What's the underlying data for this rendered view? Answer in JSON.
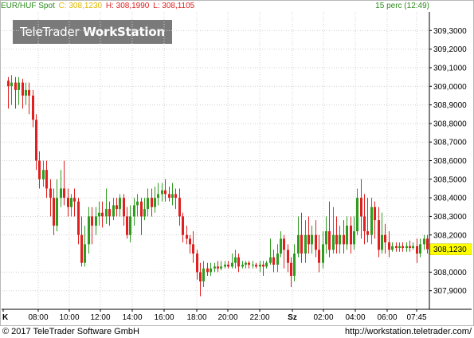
{
  "header": {
    "symbol": "EUR/HUF Spot",
    "close_label": "C: 308,1230",
    "high_label": "H: 308,1990",
    "low_label": "L: 308,1105",
    "timeframe": "15 perc (12:49)"
  },
  "logo": {
    "part1": "TeleTrader ",
    "part2": "WorkStation"
  },
  "footer": {
    "copyright": "© 2017 TeleTrader Software GmbH",
    "url": "http://workstation.teletrader.com/"
  },
  "colors": {
    "up": "#2e9c1e",
    "down": "#e02020",
    "grid": "#d0d0d0",
    "last_price_bg": "#ffff00"
  },
  "chart_data": {
    "type": "candlestick",
    "title": "EUR/HUF Spot",
    "ylim": [
      307.8,
      309.4
    ],
    "y_ticks": [
      "309,3000",
      "309,2000",
      "309,1000",
      "309,0000",
      "308,9000",
      "308,8000",
      "308,7000",
      "308,6000",
      "308,5000",
      "308,4000",
      "308,3000",
      "308,2000",
      "308,0000",
      "307,9000"
    ],
    "y_tick_values": [
      309.3,
      309.2,
      309.1,
      309.0,
      308.9,
      308.8,
      308.7,
      308.6,
      308.5,
      308.4,
      308.3,
      308.2,
      308.0,
      307.9
    ],
    "x_ticks": [
      "K",
      "08:00",
      "10:00",
      "12:00",
      "14:00",
      "16:00",
      "18:00",
      "20:00",
      "22:00",
      "Sz",
      "02:00",
      "04:00",
      "06:00",
      "07:45"
    ],
    "x_tick_bold": [
      true,
      false,
      false,
      false,
      false,
      false,
      false,
      false,
      false,
      true,
      false,
      false,
      false,
      false
    ],
    "last_price": 308.123,
    "last_price_label": "308,1230",
    "candles": [
      [
        309.03,
        309.0,
        309.05,
        308.88
      ],
      [
        309.0,
        309.02,
        309.06,
        308.9
      ],
      [
        309.02,
        308.98,
        309.05,
        308.88
      ],
      [
        308.98,
        309.02,
        309.05,
        308.9
      ],
      [
        309.02,
        308.95,
        309.04,
        308.88
      ],
      [
        308.95,
        308.98,
        309.02,
        308.9
      ],
      [
        308.98,
        308.95,
        309.02,
        308.85
      ],
      [
        308.95,
        308.82,
        308.98,
        308.78
      ],
      [
        308.82,
        308.6,
        308.85,
        308.55
      ],
      [
        308.6,
        308.5,
        308.65,
        308.45
      ],
      [
        308.5,
        308.55,
        308.6,
        308.46
      ],
      [
        308.55,
        308.45,
        308.6,
        308.4
      ],
      [
        308.45,
        308.4,
        308.5,
        308.3
      ],
      [
        308.4,
        308.25,
        308.45,
        308.2
      ],
      [
        308.25,
        308.4,
        308.5,
        308.22
      ],
      [
        308.4,
        308.45,
        308.55,
        308.35
      ],
      [
        308.45,
        308.4,
        308.6,
        308.36
      ],
      [
        308.4,
        308.35,
        308.45,
        308.3
      ],
      [
        308.35,
        308.4,
        308.42,
        308.3
      ],
      [
        308.4,
        308.38,
        308.45,
        308.3
      ],
      [
        308.38,
        308.2,
        308.4,
        308.15
      ],
      [
        308.2,
        308.05,
        308.3,
        308.03
      ],
      [
        308.05,
        308.15,
        308.25,
        308.03
      ],
      [
        308.15,
        308.3,
        308.35,
        308.1
      ],
      [
        308.3,
        308.25,
        308.35,
        308.15
      ],
      [
        308.25,
        308.3,
        308.35,
        308.2
      ],
      [
        308.3,
        308.32,
        308.38,
        308.25
      ],
      [
        308.32,
        308.3,
        308.38,
        308.24
      ],
      [
        308.3,
        308.34,
        308.45,
        308.26
      ],
      [
        308.34,
        308.3,
        308.38,
        308.25
      ],
      [
        308.3,
        308.36,
        308.4,
        308.28
      ],
      [
        308.36,
        308.34,
        308.4,
        308.3
      ],
      [
        308.34,
        308.4,
        308.42,
        308.3
      ],
      [
        308.4,
        308.3,
        308.42,
        308.25
      ],
      [
        308.3,
        308.2,
        308.35,
        308.18
      ],
      [
        308.2,
        308.3,
        308.36,
        308.16
      ],
      [
        308.3,
        308.36,
        308.4,
        308.25
      ],
      [
        308.36,
        308.38,
        308.42,
        308.3
      ],
      [
        308.38,
        308.3,
        308.4,
        308.2
      ],
      [
        308.3,
        308.34,
        308.4,
        308.28
      ],
      [
        308.34,
        308.4,
        308.45,
        308.3
      ],
      [
        308.4,
        308.35,
        308.45,
        308.3
      ],
      [
        308.35,
        308.4,
        308.46,
        308.32
      ],
      [
        308.4,
        308.42,
        308.48,
        308.36
      ],
      [
        308.42,
        308.44,
        308.48,
        308.38
      ],
      [
        308.44,
        308.42,
        308.5,
        308.38
      ],
      [
        308.42,
        308.4,
        308.46,
        308.38
      ],
      [
        308.4,
        308.42,
        308.48,
        308.36
      ],
      [
        308.42,
        308.4,
        308.45,
        308.34
      ],
      [
        308.4,
        308.3,
        308.45,
        308.25
      ],
      [
        308.3,
        308.2,
        308.32,
        308.16
      ],
      [
        308.2,
        308.18,
        308.25,
        308.15
      ],
      [
        308.18,
        308.15,
        308.2,
        308.1
      ],
      [
        308.15,
        308.1,
        308.22,
        308.05
      ],
      [
        308.1,
        308.0,
        308.12,
        307.96
      ],
      [
        308.0,
        307.95,
        308.05,
        307.87
      ],
      [
        307.95,
        308.02,
        308.06,
        307.92
      ],
      [
        308.02,
        308.0,
        308.05,
        307.98
      ],
      [
        308.0,
        308.02,
        308.05,
        307.98
      ],
      [
        308.02,
        308.03,
        308.05,
        308.0
      ],
      [
        308.03,
        308.02,
        308.06,
        308.0
      ],
      [
        308.02,
        308.03,
        308.06,
        308.01
      ],
      [
        308.03,
        308.04,
        308.06,
        308.02
      ],
      [
        308.04,
        308.03,
        308.06,
        308.02
      ],
      [
        308.03,
        308.05,
        308.1,
        308.02
      ],
      [
        308.05,
        308.08,
        308.12,
        308.02
      ],
      [
        308.08,
        308.03,
        308.1,
        308.0
      ],
      [
        308.03,
        308.04,
        308.06,
        308.02
      ],
      [
        308.04,
        308.05,
        308.06,
        308.02
      ],
      [
        308.05,
        308.04,
        308.06,
        308.02
      ],
      [
        308.04,
        308.04,
        308.06,
        308.02
      ],
      [
        308.04,
        308.03,
        308.05,
        308.02
      ],
      [
        308.03,
        308.04,
        308.06,
        308.0
      ],
      [
        308.04,
        308.03,
        308.06,
        307.98
      ],
      [
        308.03,
        308.05,
        308.06,
        308.02
      ],
      [
        308.05,
        308.08,
        308.18,
        308.04
      ],
      [
        308.08,
        308.04,
        308.12,
        308.0
      ],
      [
        308.04,
        308.1,
        308.15,
        308.0
      ],
      [
        308.1,
        308.18,
        308.22,
        308.08
      ],
      [
        308.18,
        308.12,
        308.2,
        308.02
      ],
      [
        308.12,
        308.05,
        308.15,
        308.0
      ],
      [
        308.05,
        307.98,
        308.08,
        307.92
      ],
      [
        307.98,
        308.1,
        308.15,
        307.95
      ],
      [
        308.1,
        308.2,
        308.3,
        308.08
      ],
      [
        308.2,
        308.1,
        308.32,
        308.05
      ],
      [
        308.1,
        308.2,
        308.28,
        308.05
      ],
      [
        308.2,
        308.15,
        308.3,
        308.1
      ],
      [
        308.15,
        308.2,
        308.25,
        308.1
      ],
      [
        308.2,
        308.12,
        308.28,
        308.08
      ],
      [
        308.12,
        308.05,
        308.2,
        308.0
      ],
      [
        308.05,
        308.15,
        308.22,
        308.02
      ],
      [
        308.15,
        308.22,
        308.3,
        308.1
      ],
      [
        308.22,
        308.12,
        308.38,
        308.08
      ],
      [
        308.12,
        308.2,
        308.35,
        308.1
      ],
      [
        308.2,
        308.15,
        308.3,
        308.1
      ],
      [
        308.15,
        308.2,
        308.25,
        308.1
      ],
      [
        308.2,
        308.15,
        308.28,
        308.1
      ],
      [
        308.15,
        308.25,
        308.3,
        308.12
      ],
      [
        308.25,
        308.15,
        308.3,
        308.1
      ],
      [
        308.15,
        308.22,
        308.3,
        308.12
      ],
      [
        308.22,
        308.4,
        308.45,
        308.2
      ],
      [
        308.4,
        308.3,
        308.5,
        308.18
      ],
      [
        308.3,
        308.22,
        308.42,
        308.15
      ],
      [
        308.22,
        308.2,
        308.4,
        308.16
      ],
      [
        308.2,
        308.35,
        308.4,
        308.15
      ],
      [
        308.35,
        308.28,
        308.38,
        308.18
      ],
      [
        308.28,
        308.12,
        308.35,
        308.08
      ],
      [
        308.12,
        308.2,
        308.32,
        308.1
      ],
      [
        308.2,
        308.16,
        308.26,
        308.1
      ],
      [
        308.16,
        308.12,
        308.22,
        308.08
      ],
      [
        308.12,
        308.14,
        308.16,
        308.11
      ],
      [
        308.14,
        308.13,
        308.16,
        308.11
      ],
      [
        308.13,
        308.14,
        308.16,
        308.11
      ],
      [
        308.14,
        308.13,
        308.16,
        308.11
      ],
      [
        308.13,
        308.14,
        308.16,
        308.11
      ],
      [
        308.14,
        308.13,
        308.17,
        308.11
      ],
      [
        308.13,
        308.14,
        308.16,
        308.12
      ],
      [
        308.14,
        308.1,
        308.18,
        308.05
      ],
      [
        308.1,
        308.15,
        308.18,
        308.08
      ],
      [
        308.15,
        308.18,
        308.2,
        308.12
      ],
      [
        308.18,
        308.123,
        308.2,
        308.1
      ]
    ]
  }
}
